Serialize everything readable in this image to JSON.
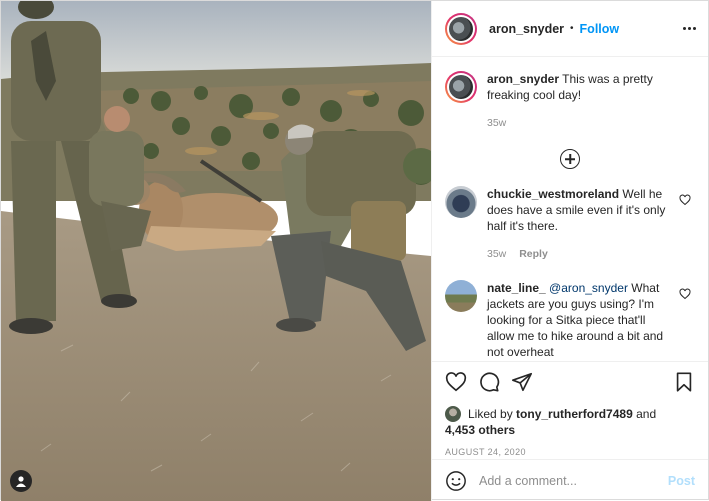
{
  "header": {
    "username": "aron_snyder",
    "separator": "•",
    "follow_label": "Follow",
    "more_icon": "more-horizontal-icon"
  },
  "caption": {
    "username": "aron_snyder",
    "text": "This was a pretty freaking cool day!",
    "age": "35w"
  },
  "comments": [
    {
      "username": "chuckie_westmoreland",
      "text": "Well he does have a smile even if it's only half it's there.",
      "age": "35w",
      "reply_label": "Reply"
    },
    {
      "username": "nate_line_",
      "mention": "@aron_snyder",
      "text": "What jackets are you guys using? I'm looking for a Sitka piece that'll allow me to hike around a bit and not overheat"
    }
  ],
  "actions": {
    "like_icon": "heart-icon",
    "comment_icon": "comment-icon",
    "share_icon": "share-icon",
    "save_icon": "bookmark-icon"
  },
  "likes": {
    "prefix": "Liked by",
    "user": "tony_rutherford7489",
    "and": "and",
    "others": "4,453 others"
  },
  "date": "AUGUST 24, 2020",
  "add_comment": {
    "placeholder": "Add a comment...",
    "post_label": "Post"
  },
  "colors": {
    "accent": "#0095f6",
    "text": "#262626",
    "muted": "#8e8e8e",
    "post_disabled": "#b2dffc"
  }
}
